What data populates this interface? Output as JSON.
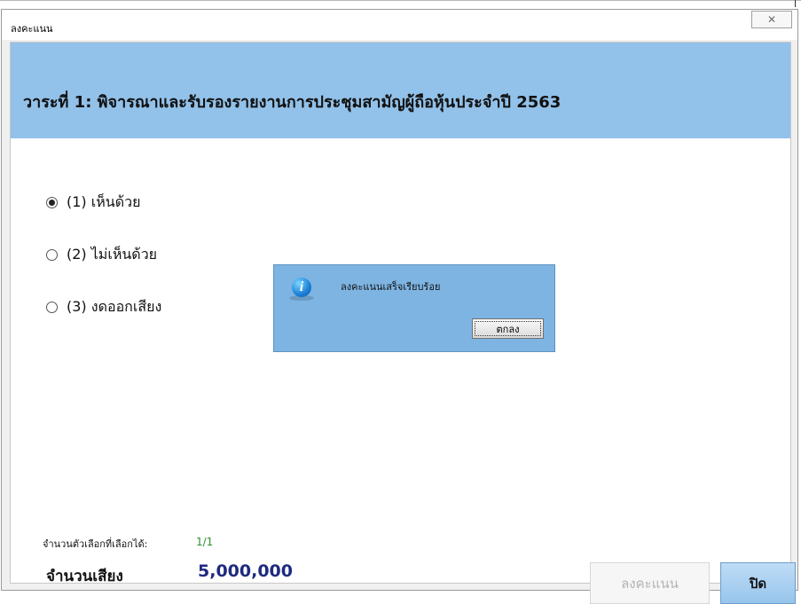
{
  "window": {
    "title": "ลงคะแนน",
    "close_glyph": "✕"
  },
  "agenda": {
    "title": "วาระที่ 1: พิจารณาและรับรองรายงานการประชุมสามัญผู้ถือหุ้นประจำปี 2563"
  },
  "options": [
    {
      "label": "(1) เห็นด้วย",
      "checked": true
    },
    {
      "label": "(2) ไม่เห็นด้วย",
      "checked": false
    },
    {
      "label": "(3) งดออกเสียง",
      "checked": false
    }
  ],
  "dialog": {
    "icon": "info-icon",
    "icon_glyph": "i",
    "message": "ลงคะแนนเสร็จเรียบร้อย",
    "ok_label": "ตกลง"
  },
  "footer": {
    "selectable_label": "จำนวนตัวเลือกที่เลือกได้:",
    "selectable_value": "1/1",
    "votes_label": "จำนวนเสียง",
    "votes_value": "5,000,000",
    "vote_button": "ลงคะแนน",
    "close_button": "ปิด"
  },
  "colors": {
    "header_band": "#92c1e9",
    "dialog_bg": "#7eb4e2",
    "votes_value": "#1e2a80",
    "selectable_value": "#2f8f2f"
  }
}
